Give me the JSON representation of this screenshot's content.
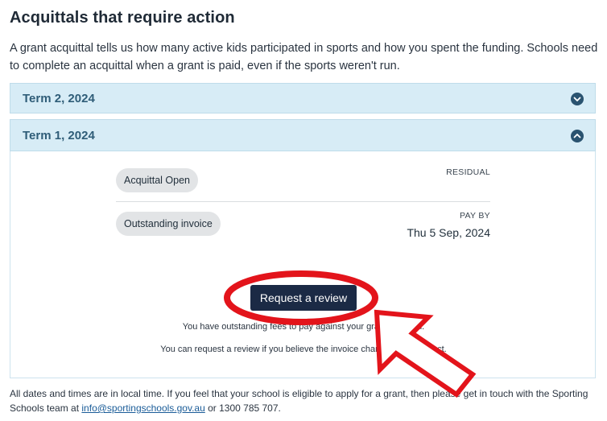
{
  "page": {
    "title": "Acquittals that require action",
    "intro": "A grant acquittal tells us how many active kids participated in sports and how you spent the funding. Schools need to complete an acquittal when a grant is paid, even if the sports weren't run."
  },
  "accordion": {
    "sections": [
      {
        "label": "Term 2, 2024",
        "expanded": false
      },
      {
        "label": "Term 1, 2024",
        "expanded": true
      }
    ],
    "panel": {
      "rows": [
        {
          "status": "Acquittal Open",
          "right_label": "RESIDUAL"
        },
        {
          "status": "Outstanding invoice",
          "right_label": "PAY BY",
          "right_value": "Thu 5 Sep, 2024"
        }
      ],
      "review_button": "Request a review",
      "note_1": "You have outstanding fees to pay against your grant acquittal.",
      "note_2": "You can request a review if you believe the invoice charges are incorrect."
    }
  },
  "footer": {
    "text_before": "All dates and times are in local time. If you feel that your school is eligible to apply for a grant, then please get in touch with the Sporting Schools team at ",
    "email": "info@sportingschools.gov.au",
    "text_after": " or 1300 785 707."
  },
  "colors": {
    "accordion_header_bg": "#d7ecf6",
    "accordion_title": "#2f5d78",
    "button_bg": "#1b2a45",
    "annotation_red": "#e3141b"
  },
  "icons": {
    "collapsed": "chevron-down-icon",
    "expanded": "chevron-up-icon"
  }
}
